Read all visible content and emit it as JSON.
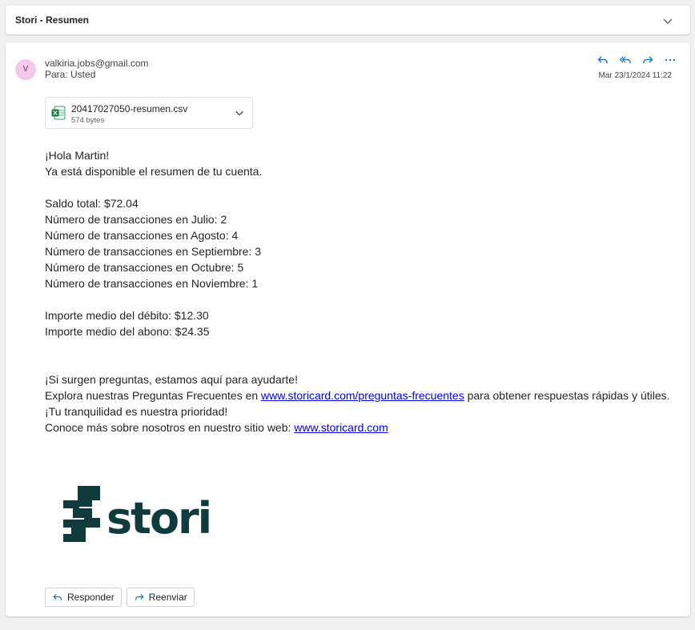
{
  "subject": {
    "title": "Stori - Resumen"
  },
  "header": {
    "avatar_initial": "V",
    "sender_email": "valkiria.jobs@gmail.com",
    "to_line": "Para:  Usted",
    "date": "Mar 23/1/2024 11:22",
    "actions": [
      "reply-icon",
      "reply-all-icon",
      "forward-icon",
      "more-icon"
    ]
  },
  "attachment": {
    "name": "20417027050-resumen.csv",
    "size": "574 bytes",
    "icon": "excel-file-icon"
  },
  "body": {
    "greeting": "¡Hola Martin!",
    "intro": "Ya está disponible el resumen de tu cuenta.",
    "saldo": "Saldo total: $72.04",
    "tx_julio": "Número de transacciones en Julio: 2",
    "tx_agosto": "Número de transacciones en Agosto: 4",
    "tx_septiembre": "Número de transacciones en Septiembre: 3",
    "tx_octubre": "Número de transacciones en Octubre: 5",
    "tx_noviembre": "Número de transacciones en Noviembre: 1",
    "debito": "Importe medio del débito: $12.30",
    "abono": "Importe medio del abono: $24.35",
    "questions": "¡Si surgen preguntas, estamos aquí para ayudarte!",
    "faq_prefix": "Explora nuestras Preguntas Frecuentes en ",
    "faq_link": "www.storicard.com/preguntas-frecuentes",
    "faq_suffix": " para obtener respuestas rápidas y útiles. ¡Tu tranquilidad es nuestra prioridad!",
    "site_prefix": "Conoce más sobre nosotros en nuestro sitio web: ",
    "site_link": "www.storicard.com"
  },
  "logo": {
    "text": "stori",
    "color": "#0f3b3c"
  },
  "footer": {
    "reply_label": "Responder",
    "forward_label": "Reenviar"
  },
  "colors": {
    "accent": "#0f6cbd",
    "link": "#0000ee",
    "avatar_bg": "#f3c8e8"
  }
}
